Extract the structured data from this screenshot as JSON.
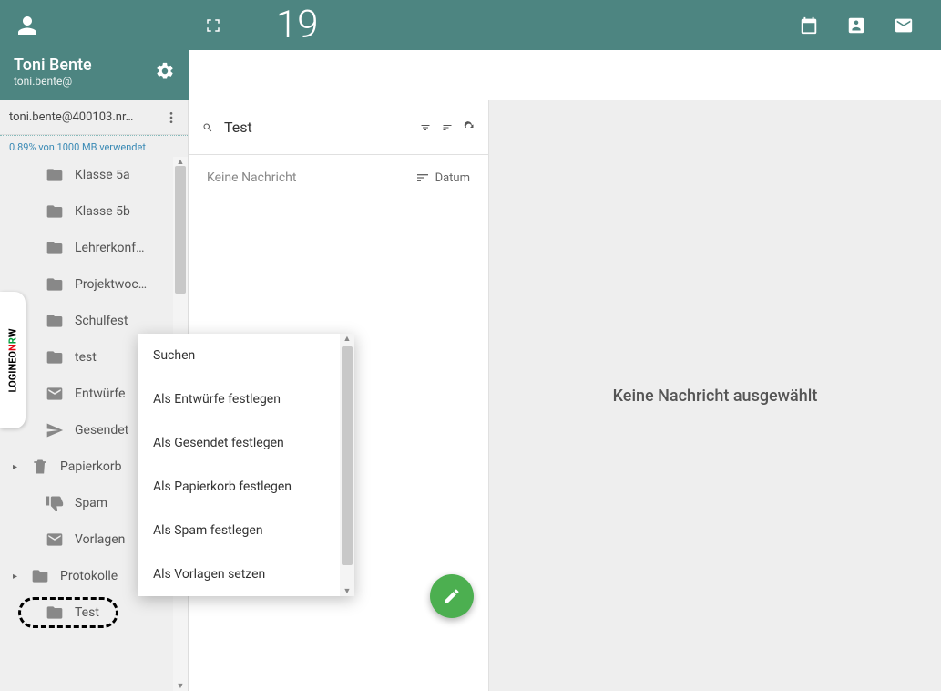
{
  "header": {
    "date_day": "19",
    "date_weekday": ""
  },
  "profile": {
    "name": "Toni Bente",
    "email": "toni.bente@"
  },
  "account": {
    "address": "toni.bente@400103.nr…",
    "storage": "0.89% von 1000 MB verwendet"
  },
  "folders": [
    {
      "label": "Klasse 5a",
      "type": "folder",
      "indent": 2
    },
    {
      "label": "Klasse 5b",
      "type": "folder",
      "indent": 2
    },
    {
      "label": "Lehrerkonf…",
      "type": "folder",
      "indent": 2
    },
    {
      "label": "Projektwoc…",
      "type": "folder",
      "indent": 2
    },
    {
      "label": "Schulfest",
      "type": "folder",
      "indent": 2
    },
    {
      "label": "test",
      "type": "folder",
      "indent": 2
    },
    {
      "label": "Entwürfe",
      "type": "drafts",
      "indent": 1
    },
    {
      "label": "Gesendet",
      "type": "sent",
      "indent": 1
    },
    {
      "label": "Papierkorb",
      "type": "trash",
      "indent": 1,
      "expandable": true
    },
    {
      "label": "Spam",
      "type": "spam",
      "indent": 1
    },
    {
      "label": "Vorlagen",
      "type": "templates",
      "indent": 1
    },
    {
      "label": "Protokolle",
      "type": "folder",
      "indent": 1,
      "expandable": true
    },
    {
      "label": "Test",
      "type": "folder",
      "indent": 1,
      "highlighted": true
    }
  ],
  "search": {
    "value": "Test"
  },
  "messages": {
    "empty": "Keine Nachricht",
    "sort_label": "Datum"
  },
  "context_menu": [
    "Suchen",
    "Als Entwürfe festlegen",
    "Als Gesendet festlegen",
    "Als Papierkorb festlegen",
    "Als Spam festlegen",
    "Als Vorlagen setzen"
  ],
  "preview": {
    "empty": "Keine Nachricht ausgewählt"
  },
  "logineo": {
    "brand": "LOGINEO",
    "suffix": "NRW"
  }
}
